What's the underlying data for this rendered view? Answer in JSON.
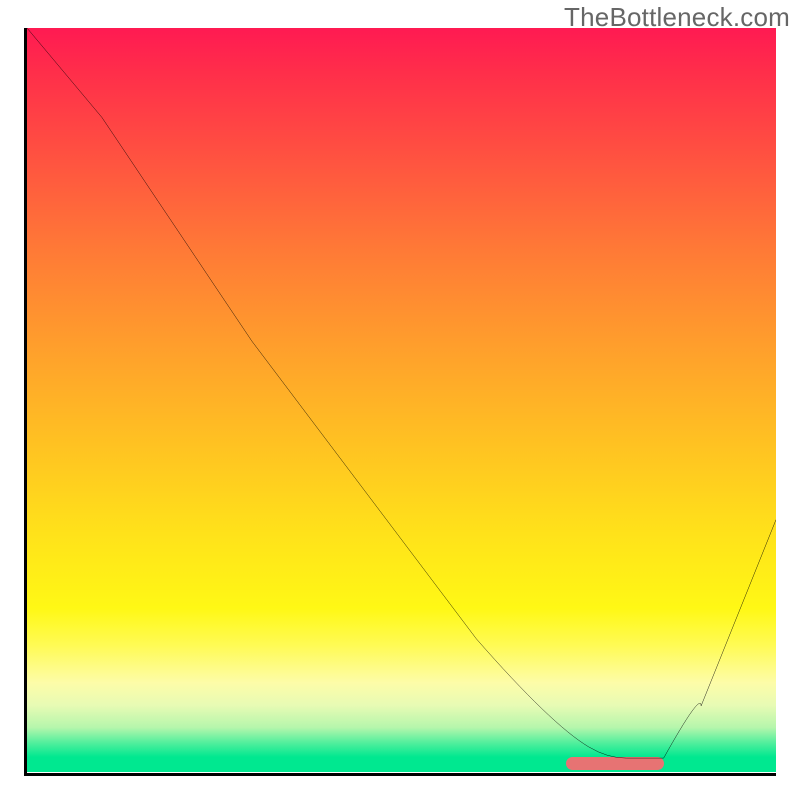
{
  "watermark": "TheBottleneck.com",
  "colors": {
    "gradient_top": "#ff1a52",
    "gradient_mid": "#ffe21a",
    "gradient_bottom": "#00e890",
    "curve": "#000000",
    "marker": "#e77373",
    "axis": "#000000"
  },
  "chart_data": {
    "type": "line",
    "title": "",
    "xlabel": "",
    "ylabel": "",
    "xlim": [
      0,
      100
    ],
    "ylim": [
      0,
      100
    ],
    "grid": false,
    "note": "No numeric axes are rendered; x/y are normalized 0-100 estimates read from pixel positions.",
    "series": [
      {
        "name": "bottleneck-curve",
        "x": [
          0,
          10,
          18,
          30,
          45,
          60,
          70,
          75,
          80,
          85,
          90,
          100
        ],
        "y": [
          100,
          88,
          76,
          58,
          38,
          18,
          6.5,
          3.5,
          2,
          2,
          9,
          34
        ]
      }
    ],
    "marker": {
      "name": "optimal-region",
      "x_start": 72,
      "x_end": 85,
      "y": 1.3
    },
    "background_gradient": {
      "orientation": "vertical",
      "stops": [
        {
          "pos": 0.0,
          "color": "#ff1a52"
        },
        {
          "pos": 0.18,
          "color": "#ff5440"
        },
        {
          "pos": 0.44,
          "color": "#ffa22b"
        },
        {
          "pos": 0.68,
          "color": "#ffe21a"
        },
        {
          "pos": 0.88,
          "color": "#fdfca8"
        },
        {
          "pos": 0.96,
          "color": "#55ef9d"
        },
        {
          "pos": 1.0,
          "color": "#00e890"
        }
      ]
    }
  }
}
